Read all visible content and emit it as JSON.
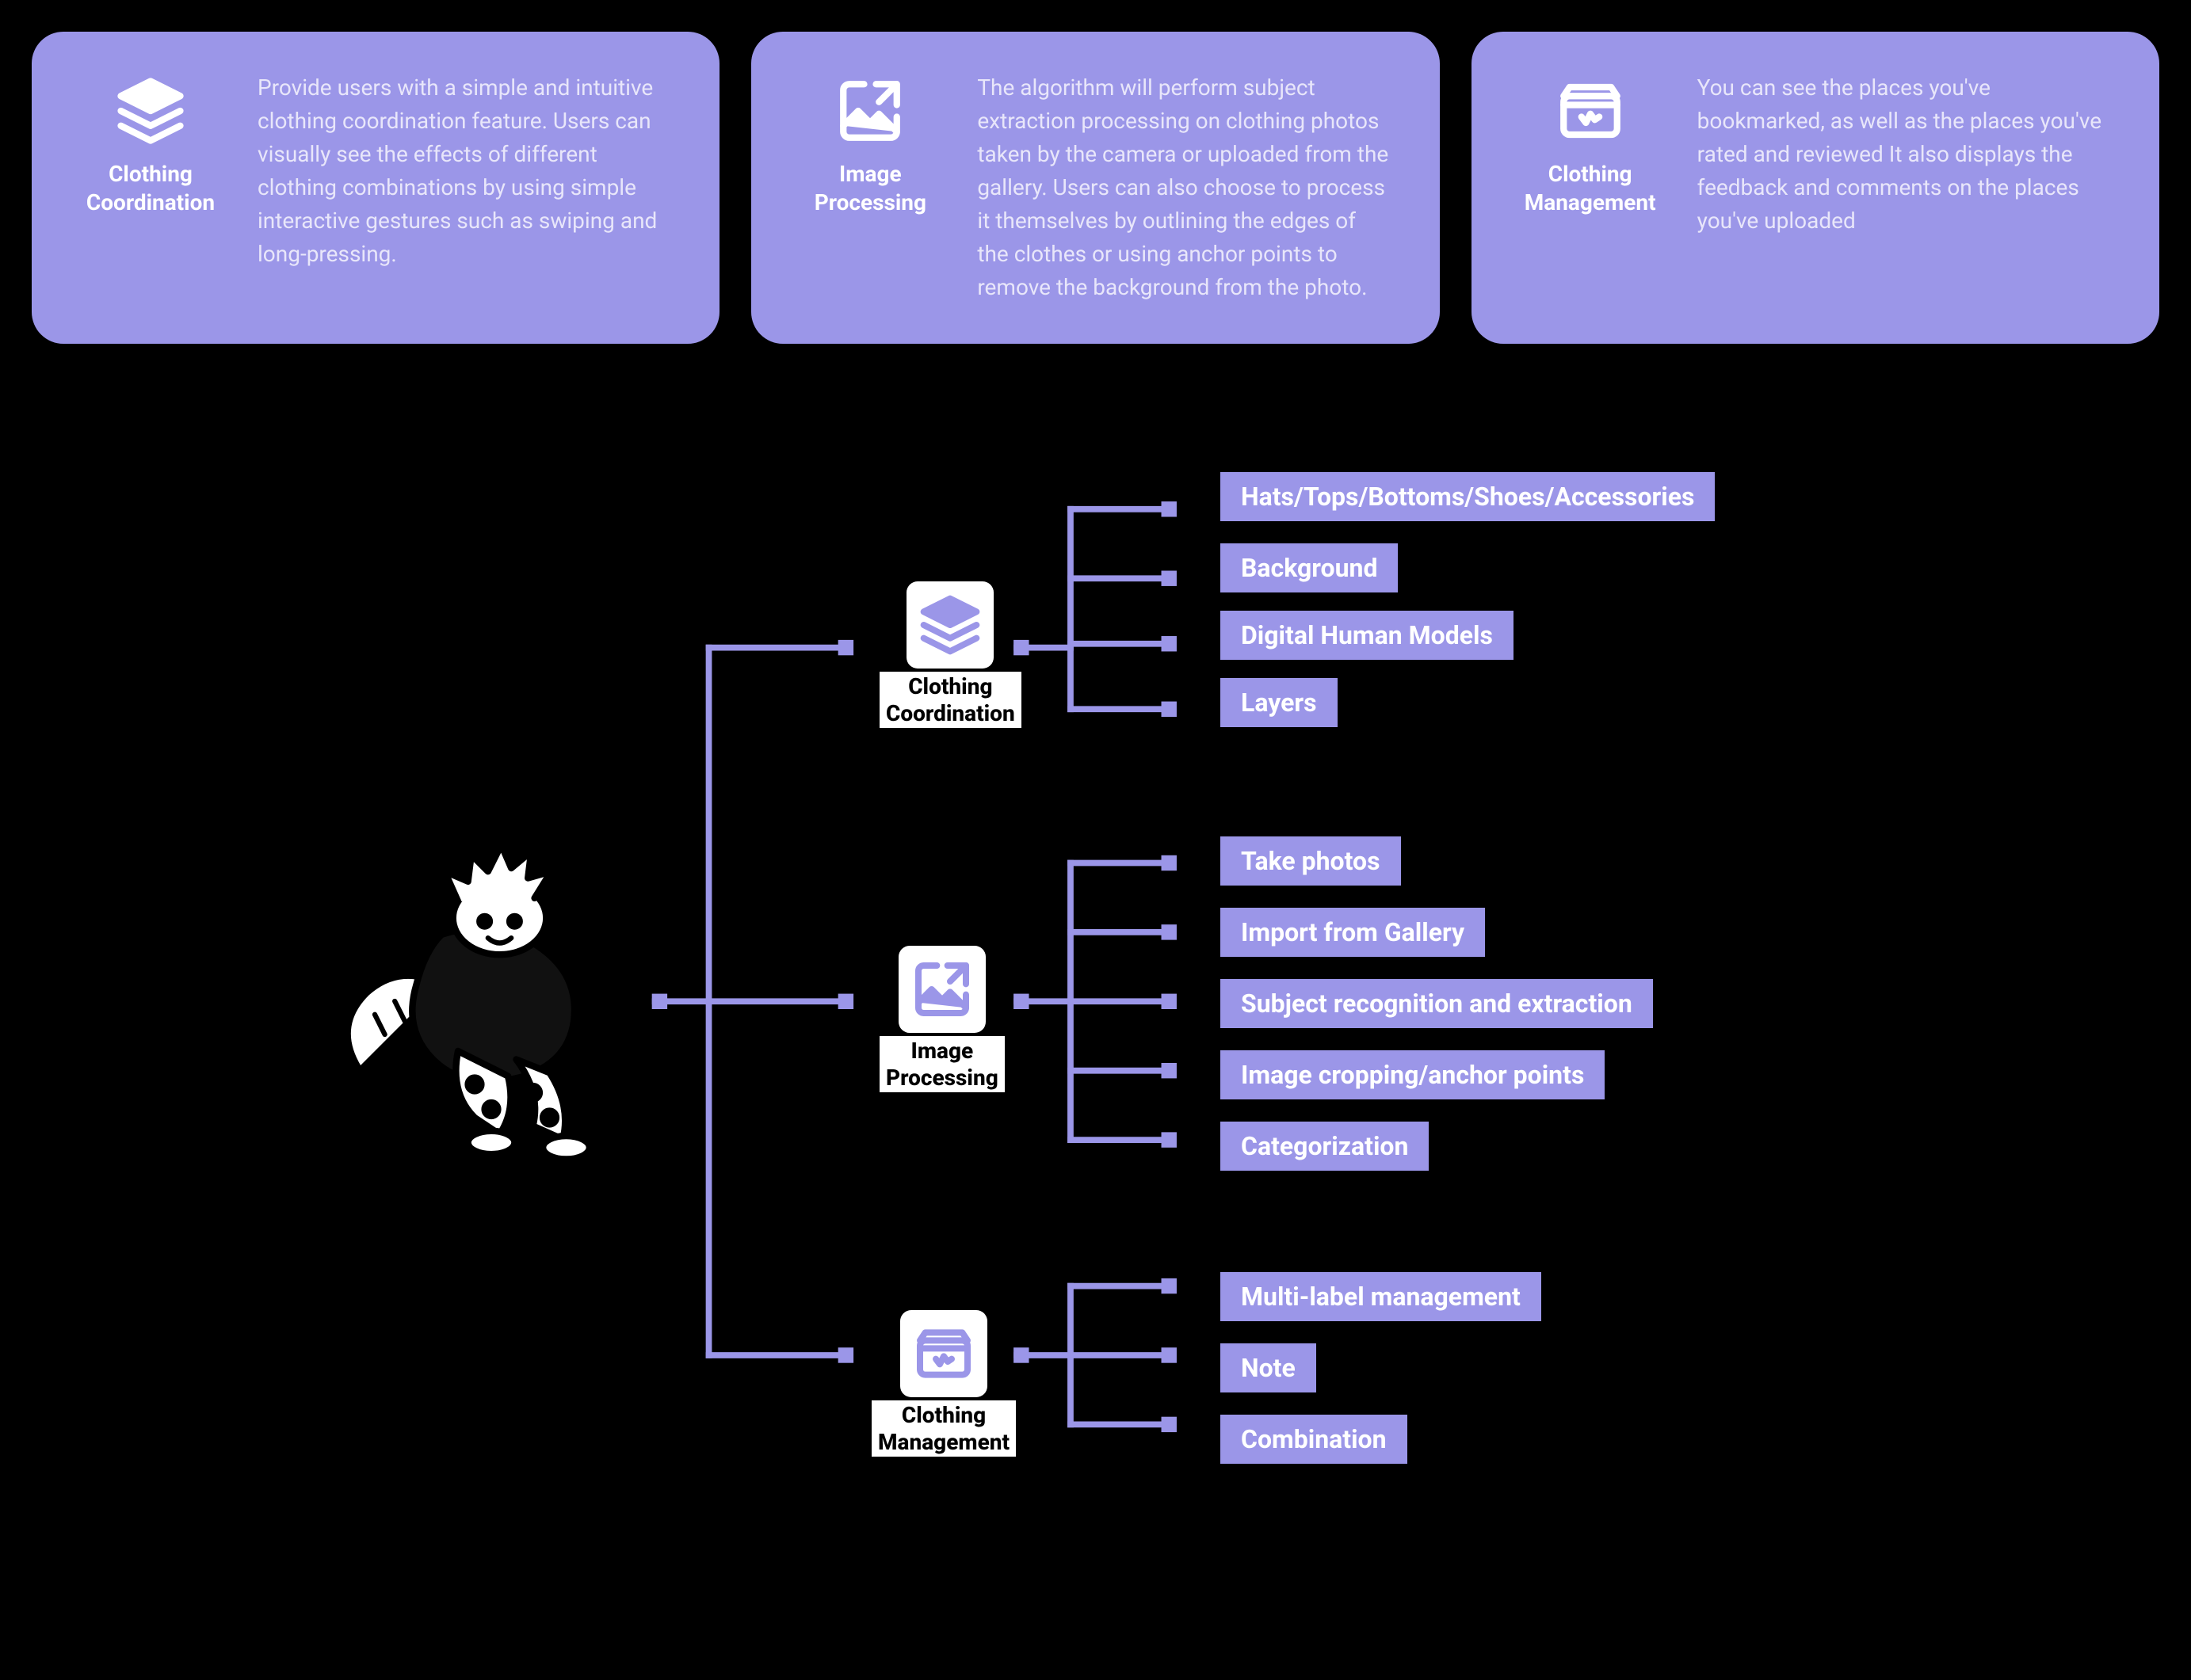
{
  "cards": [
    {
      "title": "Clothing\nCoordination",
      "desc": "Provide users with a simple and intuitive clothing coordination feature. Users can visually see the effects of different clothing combinations by using simple interactive gestures such as swiping and long-pressing."
    },
    {
      "title": "Image\nProcessing",
      "desc": "The algorithm will perform subject extraction processing on clothing photos taken by the camera or uploaded from the gallery. Users can also choose to process it themselves by outlining the edges of the clothes or using anchor points to remove the background from the photo."
    },
    {
      "title": "Clothing\nManagement",
      "desc": "You can see the places you've bookmarked, as well as the places you've rated and reviewed  It also displays the feedback and comments on the places you've uploaded"
    }
  ],
  "categories": [
    {
      "label": "Clothing\nCoordination",
      "leaves": [
        "Hats/Tops/Bottoms/Shoes/Accessories",
        "Background",
        "Digital Human Models",
        "Layers"
      ]
    },
    {
      "label": "Image\nProcessing",
      "leaves": [
        "Take  photos",
        "Import from Gallery",
        "Subject recognition and extraction",
        "Image cropping/anchor points",
        "Categorization"
      ]
    },
    {
      "label": "Clothing\nManagement",
      "leaves": [
        "Multi-label management",
        "Note",
        "Combination"
      ]
    }
  ]
}
